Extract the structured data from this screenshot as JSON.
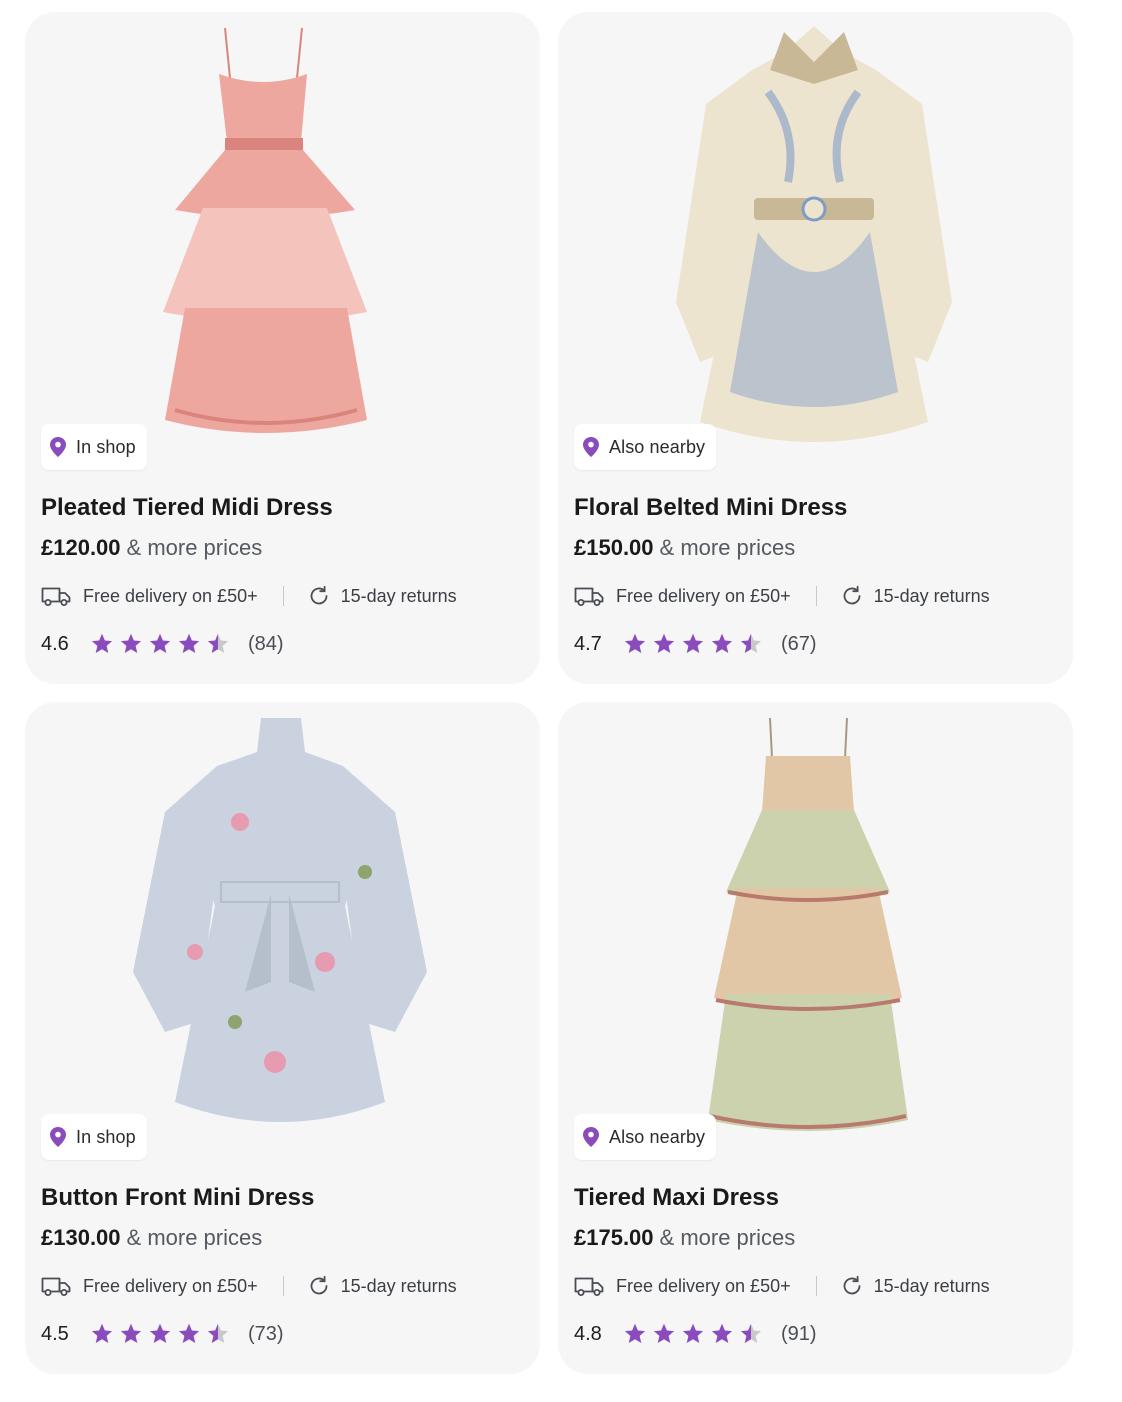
{
  "theme": {
    "accent": "#8a4bbd",
    "card_bg": "#f6f6f7",
    "star_empty": "#c8c8cc"
  },
  "products": [
    {
      "title": "Pleated Tiered Midi Dress",
      "price": "£120.00",
      "more_prices": "& more prices",
      "badge": "In shop",
      "delivery": "Free delivery on £50+",
      "returns": "15-day returns",
      "rating": "4.6",
      "rating_value": 4.5,
      "reviews": "(84)",
      "image": {
        "icon": "dress-photo",
        "palette": [
          "#eda79f",
          "#d9857d",
          "#f4c3bc"
        ]
      }
    },
    {
      "title": "Floral Belted Mini Dress",
      "price": "£150.00",
      "more_prices": "& more prices",
      "badge": "Also nearby",
      "delivery": "Free delivery on £50+",
      "returns": "15-day returns",
      "rating": "4.7",
      "rating_value": 4.5,
      "reviews": "(67)",
      "image": {
        "icon": "dress-photo",
        "palette": [
          "#ede4d0",
          "#7f9cc7",
          "#c9b896"
        ]
      }
    },
    {
      "title": "Button Front Mini Dress",
      "price": "£130.00",
      "more_prices": "& more prices",
      "badge": "In shop",
      "delivery": "Free delivery on £50+",
      "returns": "15-day returns",
      "rating": "4.5",
      "rating_value": 4.5,
      "reviews": "(73)",
      "image": {
        "icon": "dress-photo",
        "palette": [
          "#c9d2de",
          "#e69bb1",
          "#8ea36d"
        ]
      }
    },
    {
      "title": "Tiered Maxi Dress",
      "price": "£175.00",
      "more_prices": "& more prices",
      "badge": "Also nearby",
      "delivery": "Free delivery on £50+",
      "returns": "15-day returns",
      "rating": "4.8",
      "rating_value": 4.5,
      "reviews": "(91)",
      "image": {
        "icon": "dress-photo",
        "palette": [
          "#cbd2ad",
          "#e2c7a6",
          "#b97a6e"
        ]
      }
    }
  ]
}
